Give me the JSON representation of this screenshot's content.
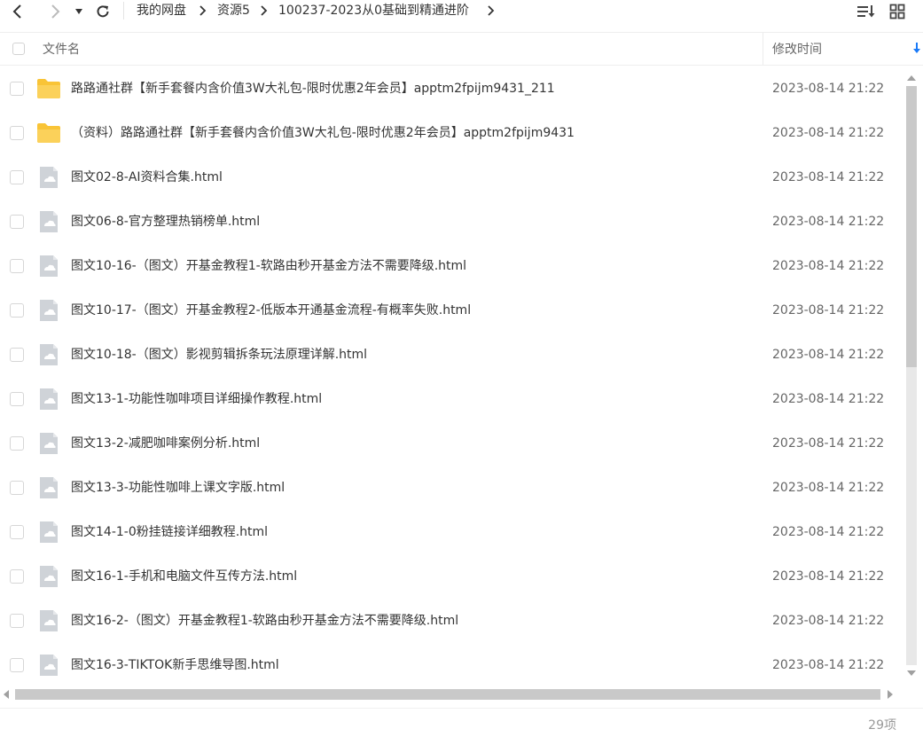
{
  "nav": {
    "back_icon": "chevron-left-icon",
    "forward_icon": "chevron-right-icon",
    "history_icon": "caret-down-icon",
    "refresh_icon": "refresh-icon",
    "breadcrumbs": [
      "我的网盘",
      "资源5",
      "100237-2023从0基础到精通进阶"
    ],
    "sort_view_icon": "sort-list-icon",
    "grid_view_icon": "grid-view-icon"
  },
  "header": {
    "name_label": "文件名",
    "time_label": "修改时间",
    "sort_icon": "sort-arrow-down-icon"
  },
  "files": [
    {
      "type": "folder",
      "name": "路路通社群【新手套餐内含价值3W大礼包-限时优惠2年会员】apptm2fpijm9431_211",
      "time": "2023-08-14 21:22"
    },
    {
      "type": "folder",
      "name": "（资料）路路通社群【新手套餐内含价值3W大礼包-限时优惠2年会员】apptm2fpijm9431",
      "time": "2023-08-14 21:22"
    },
    {
      "type": "file",
      "name": "图文02-8-AI资料合集.html",
      "time": "2023-08-14 21:22"
    },
    {
      "type": "file",
      "name": "图文06-8-官方整理热销榜单.html",
      "time": "2023-08-14 21:22"
    },
    {
      "type": "file",
      "name": "图文10-16-（图文）开基金教程1-软路由秒开基金方法不需要降级.html",
      "time": "2023-08-14 21:22"
    },
    {
      "type": "file",
      "name": "图文10-17-（图文）开基金教程2-低版本开通基金流程-有概率失败.html",
      "time": "2023-08-14 21:22"
    },
    {
      "type": "file",
      "name": "图文10-18-（图文）影视剪辑拆条玩法原理详解.html",
      "time": "2023-08-14 21:22"
    },
    {
      "type": "file",
      "name": "图文13-1-功能性咖啡项目详细操作教程.html",
      "time": "2023-08-14 21:22"
    },
    {
      "type": "file",
      "name": "图文13-2-减肥咖啡案例分析.html",
      "time": "2023-08-14 21:22"
    },
    {
      "type": "file",
      "name": "图文13-3-功能性咖啡上课文字版.html",
      "time": "2023-08-14 21:22"
    },
    {
      "type": "file",
      "name": "图文14-1-0粉挂链接详细教程.html",
      "time": "2023-08-14 21:22"
    },
    {
      "type": "file",
      "name": "图文16-1-手机和电脑文件互传方法.html",
      "time": "2023-08-14 21:22"
    },
    {
      "type": "file",
      "name": "图文16-2-（图文）开基金教程1-软路由秒开基金方法不需要降级.html",
      "time": "2023-08-14 21:22"
    },
    {
      "type": "file",
      "name": "图文16-3-TIKTOK新手思维导图.html",
      "time": "2023-08-14 21:22"
    }
  ],
  "status": {
    "count": "29项"
  },
  "colors": {
    "folder": "#f9c437",
    "file_icon": "#cfd3d8",
    "accent": "#1a7af8"
  }
}
